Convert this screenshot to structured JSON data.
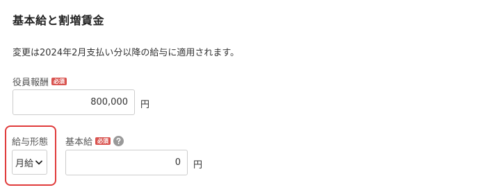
{
  "section": {
    "title": "基本給と割増賃金",
    "note": "変更は2024年2月支払い分以降の給与に適用されます。"
  },
  "required_badge": "必須",
  "officer_compensation": {
    "label": "役員報酬",
    "value": "800,000",
    "unit": "円"
  },
  "pay_type": {
    "label": "給与形態",
    "selected": "月給"
  },
  "base_salary": {
    "label": "基本給",
    "value": "0",
    "unit": "円"
  },
  "colors": {
    "badge": "#d9534f",
    "highlight": "#e03a3a",
    "help_icon": "#999999"
  },
  "icons": {
    "help": "question-circle-icon",
    "select": "chevron-down-icon"
  }
}
